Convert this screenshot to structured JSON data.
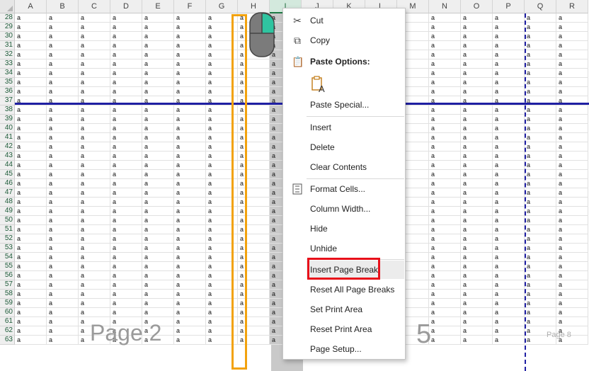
{
  "columns": [
    "A",
    "B",
    "C",
    "D",
    "E",
    "F",
    "G",
    "H",
    "I",
    "J",
    "K",
    "L",
    "M",
    "N",
    "O",
    "P",
    "Q",
    "R"
  ],
  "selected_column": "I",
  "row_start": 28,
  "row_end": 63,
  "cell_value": "a",
  "watermarks": {
    "page2": "Page 2",
    "page5": "5",
    "page8": "Page 8"
  },
  "context_menu": {
    "cut": "Cut",
    "copy": "Copy",
    "paste_options": "Paste Options:",
    "paste_special": "Paste Special...",
    "insert": "Insert",
    "delete": "Delete",
    "clear_contents": "Clear Contents",
    "format_cells": "Format Cells...",
    "column_width": "Column Width...",
    "hide": "Hide",
    "unhide": "Unhide",
    "insert_page_break": "Insert Page Break",
    "reset_all_page_breaks": "Reset All Page Breaks",
    "set_print_area": "Set Print Area",
    "reset_print_area": "Reset Print Area",
    "page_setup": "Page Setup..."
  },
  "colors": {
    "page_break_line": "#1f1fa3",
    "highlight_orange": "#f2a20e",
    "highlight_red": "#e8101a",
    "mouse_button": "#2fc4a0",
    "header_selected": "#d3e9dd"
  }
}
